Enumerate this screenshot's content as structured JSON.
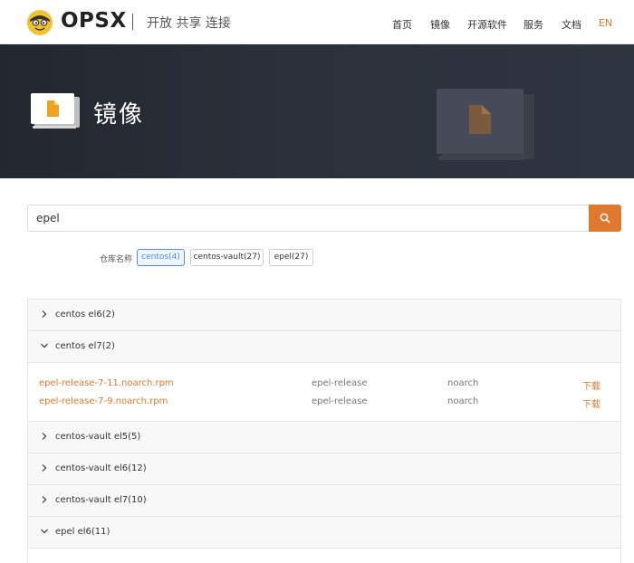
{
  "header": {
    "brand": "OPSX",
    "slogan": "开放 共享 连接",
    "nav": [
      "首页",
      "镜像",
      "开源软件",
      "服务",
      "文档",
      "EN"
    ]
  },
  "banner": {
    "title": "镜像"
  },
  "search": {
    "value": "epel"
  },
  "filter": {
    "label": "仓库名称",
    "tags": [
      "centos(4)",
      "centos-vault(27)",
      "epel(27)"
    ],
    "active_tag": "centos(4)"
  },
  "groups": [
    {
      "label": "centos el6(2)",
      "expanded": false
    },
    {
      "label": "centos el7(2)",
      "expanded": true,
      "files": [
        {
          "filename": "epel-release-7-11.noarch.rpm",
          "name": "epel-release",
          "arch": "noarch",
          "action": "下载"
        },
        {
          "filename": "epel-release-7-9.noarch.rpm",
          "name": "epel-release",
          "arch": "noarch",
          "action": "下载"
        }
      ]
    },
    {
      "label": "centos-vault el5(5)",
      "expanded": false
    },
    {
      "label": "centos-vault el6(12)",
      "expanded": false
    },
    {
      "label": "centos-vault el7(10)",
      "expanded": false
    },
    {
      "label": "epel el6(11)",
      "expanded": true
    }
  ],
  "colors": {
    "accent": "#e0782f",
    "active_tag": "#4a8ee8",
    "banner_bg": "#2b303a"
  }
}
